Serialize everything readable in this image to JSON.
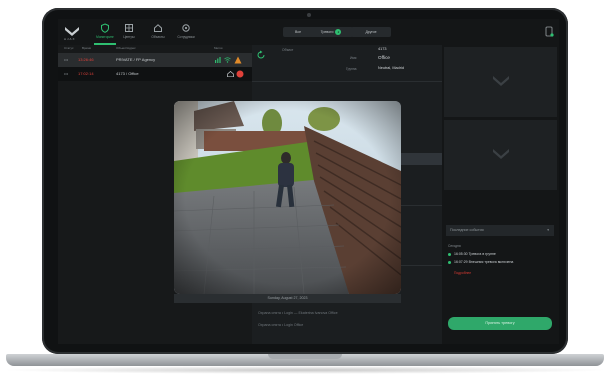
{
  "app": {
    "logo_text": "AJAX"
  },
  "nav": {
    "items": [
      {
        "label": "Мониторинг",
        "icon": "shield-icon",
        "active": true
      },
      {
        "label": "Центры",
        "icon": "grid-icon",
        "active": false
      },
      {
        "label": "Объекты",
        "icon": "home-icon",
        "active": false
      },
      {
        "label": "Сотрудники",
        "icon": "gear-icon",
        "active": false
      }
    ]
  },
  "tabs": [
    {
      "label": "Все"
    },
    {
      "label": "Тревоги",
      "badge": "2"
    },
    {
      "label": "Другое"
    }
  ],
  "list": {
    "headers": [
      "Статус",
      "Время",
      "Объект/Адрес",
      "Метки"
    ],
    "rows": [
      {
        "menu": "•••",
        "time": "13:26:46",
        "text": "PRIVATE / FP Agency"
      },
      {
        "menu": "•••",
        "time": "17:02:14",
        "text": "4173 / Office"
      }
    ]
  },
  "detail": {
    "id_label": "Объект",
    "id_value": "4173",
    "name_label": "Имя",
    "name_value": "Office",
    "group_label": "Группа",
    "group_value": "Neutral, Madrid",
    "bottom_rows": [
      "Охрана снята  •  Login — Ekaterina Ivanova Office",
      "Охрана снята  •  Login Office"
    ]
  },
  "right": {
    "dropdown": "Последние события",
    "events_label": "Сегодня",
    "events": [
      {
        "text": "16:05:30 Тревога в группе"
      },
      {
        "text": "16:07:29 Внешняя тревога включена"
      }
    ],
    "link": "Подробнее",
    "action_button": "Принять тревогу"
  },
  "overlay": {
    "caption": "Sunday, August 27, 2023"
  },
  "colors": {
    "accent": "#2fbf71",
    "alarm": "#e0413a",
    "background": "#17191a"
  }
}
